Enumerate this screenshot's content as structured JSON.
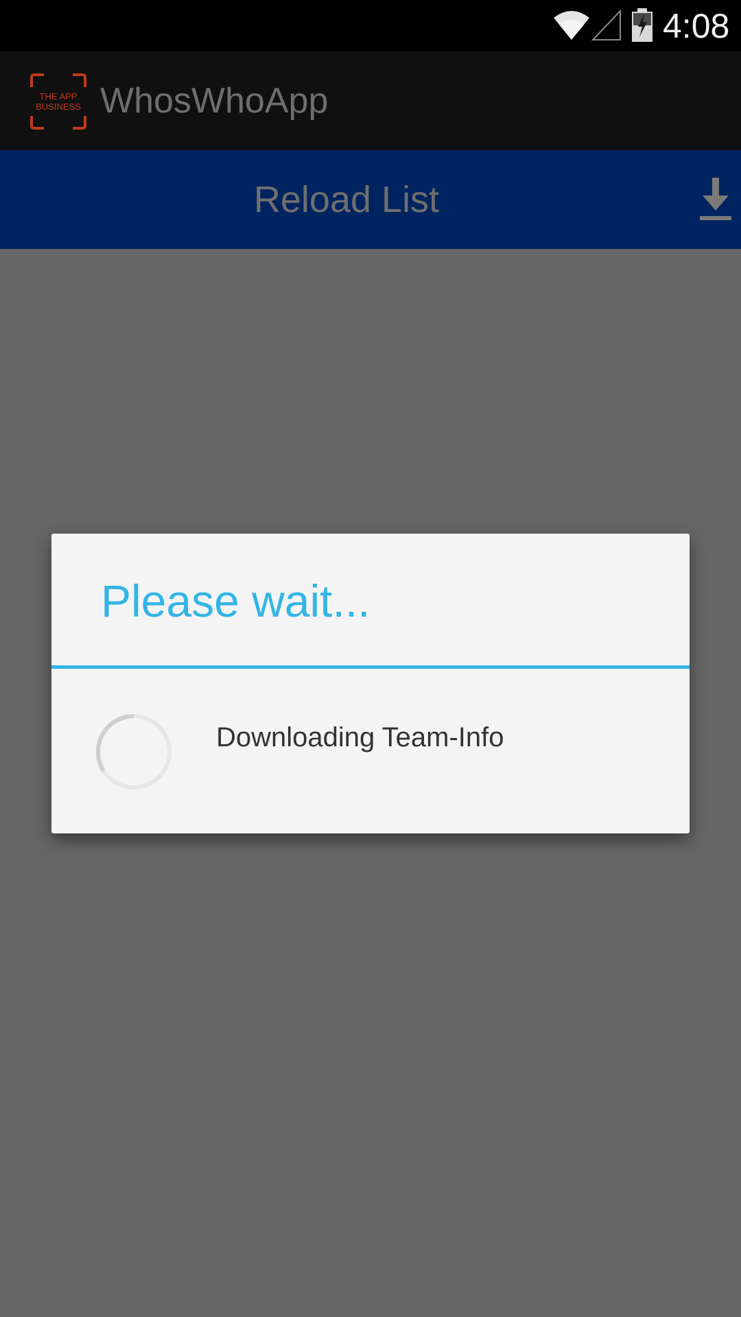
{
  "status_bar": {
    "time": "4:08",
    "icons": [
      "wifi-icon",
      "cell-signal-icon",
      "battery-charging-icon"
    ]
  },
  "action_bar": {
    "app_title": "WhosWhoApp",
    "logo_text_line1": "THE APP",
    "logo_text_line2": "BUSINESS"
  },
  "reload_bar": {
    "label": "Reload List",
    "icon": "download-icon"
  },
  "dialog": {
    "title": "Please wait...",
    "message": "Downloading Team-Info"
  },
  "colors": {
    "accent": "#33b5e5",
    "reload_bar": "#00245f",
    "logo": "#c0391b",
    "overlay": "#666666"
  }
}
